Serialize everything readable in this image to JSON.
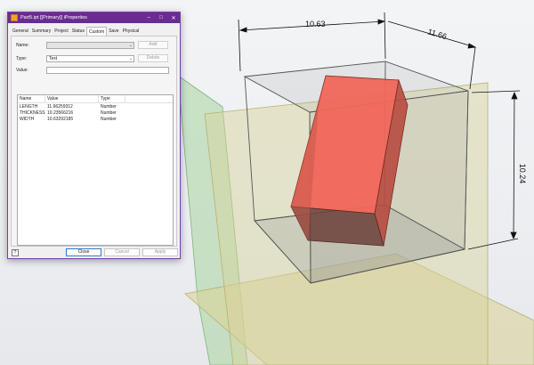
{
  "dialog": {
    "title": "Part5.ipt [[Primary]] iProperties",
    "window_controls": {
      "minimize": "–",
      "maximize": "□",
      "close": "✕"
    },
    "tabs": [
      {
        "label": "General",
        "active": false
      },
      {
        "label": "Summary",
        "active": false
      },
      {
        "label": "Project",
        "active": false
      },
      {
        "label": "Status",
        "active": false
      },
      {
        "label": "Custom",
        "active": true
      },
      {
        "label": "Save",
        "active": false
      },
      {
        "label": "Physical",
        "active": false
      }
    ],
    "fields": {
      "name_label": "Name:",
      "name_value": "",
      "type_label": "Type:",
      "type_value": "Text",
      "value_label": "Value:",
      "value_value": ""
    },
    "buttons": {
      "add": "Add",
      "delete": "Delete",
      "close": "Close",
      "cancel": "Cancel",
      "apply": "Apply"
    },
    "help_icon": "?",
    "grid": {
      "columns": [
        "Name",
        "Value",
        "Type"
      ],
      "rows": [
        {
          "name": "LENGTH",
          "value": "11.66259312",
          "type": "Number"
        },
        {
          "name": "THICKNESS",
          "value": "10.23566216",
          "type": "Number"
        },
        {
          "name": "WIDTH",
          "value": "10.63292185",
          "type": "Number"
        }
      ]
    }
  },
  "viewport": {
    "dimensions": {
      "length": "10.63",
      "depth": "11.66",
      "height": "10.24"
    },
    "colors": {
      "red_solid": "#e05a4f",
      "yellow_plane": "#d8d39a",
      "green_plane": "#a9d6a1",
      "title_bar": "#6a2c91"
    }
  }
}
